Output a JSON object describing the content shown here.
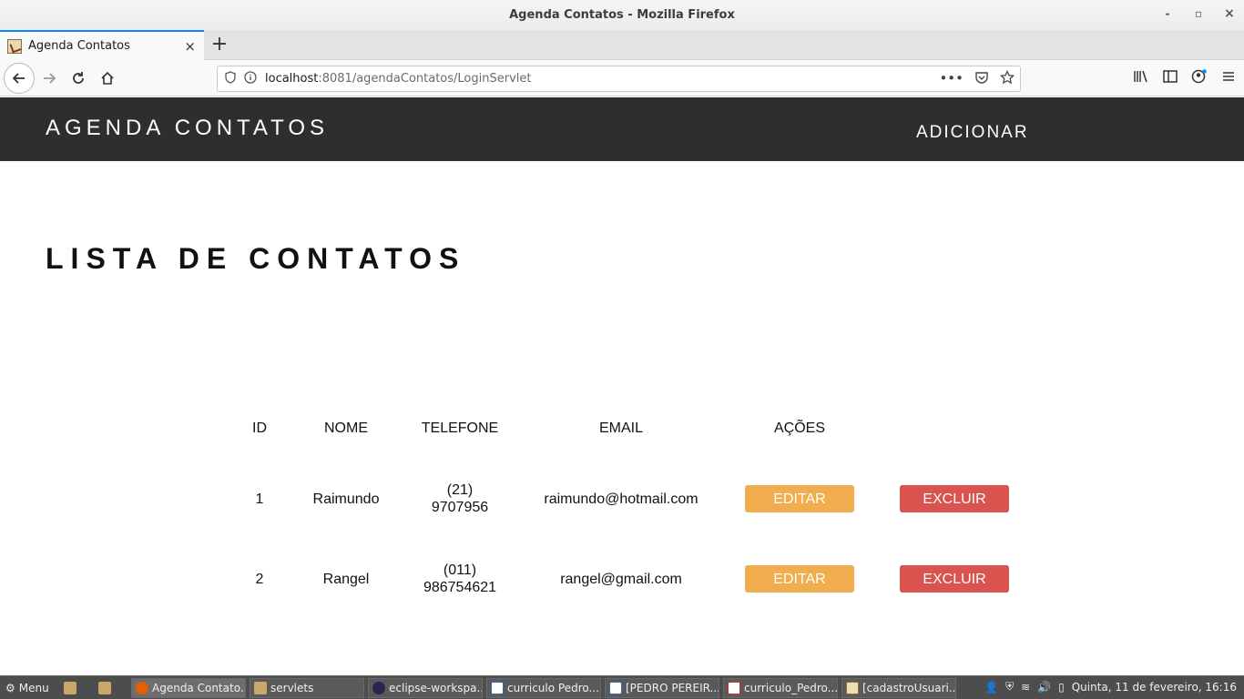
{
  "window": {
    "title": "Agenda Contatos - Mozilla Firefox",
    "minimize": "-",
    "maximize": "▫",
    "close": "×"
  },
  "browser": {
    "tab_title": "Agenda Contatos",
    "tab_close": "×",
    "new_tab": "+",
    "url_host": "localhost",
    "url_path": ":8081/agendaContatos/LoginServlet",
    "icons": [
      "back-icon",
      "forward-icon",
      "reload-icon",
      "home-icon",
      "shield-icon",
      "info-icon",
      "more-icon",
      "pocket-icon",
      "star-icon",
      "library-icon",
      "sidebar-icon",
      "account-icon",
      "menu-icon"
    ]
  },
  "header": {
    "brand": "AGENDA CONTATOS",
    "add_link": "ADICIONAR"
  },
  "main": {
    "title": "LISTA DE CONTATOS"
  },
  "table": {
    "columns": [
      "ID",
      "NOME",
      "TELEFONE",
      "EMAIL",
      "AÇÕES"
    ],
    "rows": [
      {
        "id": "1",
        "nome": "Raimundo",
        "telefone_1": "(21)",
        "telefone_2": "9707956",
        "email": "raimundo@hotmail.com",
        "edit": "EDITAR",
        "delete": "EXCLUIR"
      },
      {
        "id": "2",
        "nome": "Rangel",
        "telefone_1": "(011)",
        "telefone_2": "986754621",
        "email": "rangel@gmail.com",
        "edit": "EDITAR",
        "delete": "EXCLUIR"
      }
    ]
  },
  "colors": {
    "header_bg": "#2d2e2f",
    "edit_button": "#f0ad4e",
    "delete_button": "#d9534f",
    "accent": "#0a84ff"
  },
  "taskbar": {
    "menu": "Menu",
    "items": [
      "Agenda Contato...",
      "servlets",
      "eclipse-workspa...",
      "curriculo Pedro....",
      "[PEDRO PEREIR...",
      "curriculo_Pedro...",
      "[cadastroUsuari..."
    ],
    "clock": "Quinta, 11 de fevereiro, 16:16"
  }
}
